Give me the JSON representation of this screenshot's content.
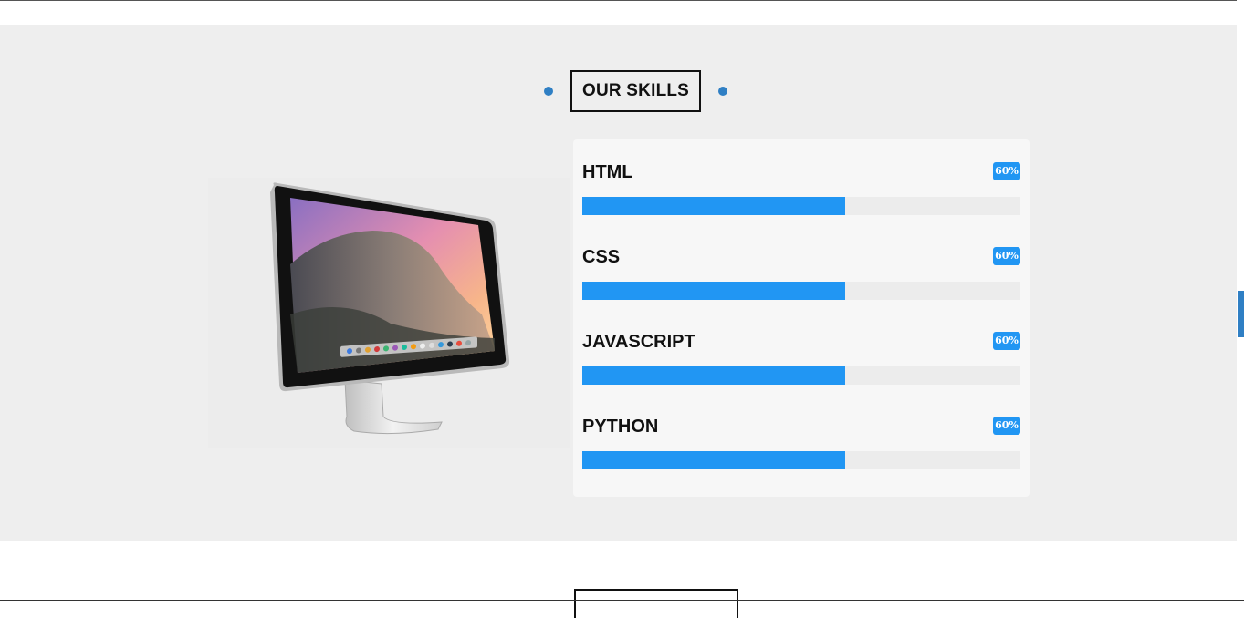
{
  "section": {
    "heading": "OUR SKILLS"
  },
  "skills": [
    {
      "name": "HTML",
      "badge": "60%",
      "level": 0.6
    },
    {
      "name": "CSS",
      "badge": "60%",
      "level": 0.6
    },
    {
      "name": "JAVASCRIPT",
      "badge": "60%",
      "level": 0.6
    },
    {
      "name": "PYTHON",
      "badge": "60%",
      "level": 0.6
    }
  ],
  "colors": {
    "accent": "#2196f3",
    "dot": "#2f7fc4",
    "section_bg": "#eeeeee",
    "card_bg": "#f7f7f7",
    "track": "#ececec"
  },
  "image": {
    "icon": "desktop-monitor-image"
  }
}
